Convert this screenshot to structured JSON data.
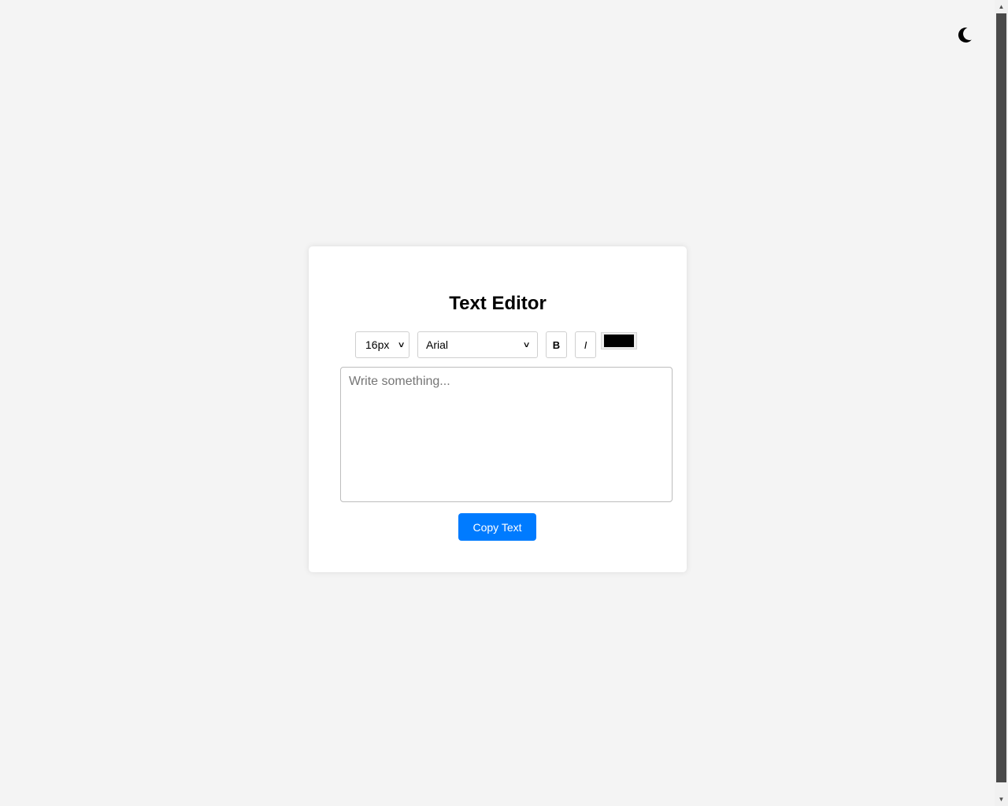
{
  "theme_toggle": {
    "icon": "moon-icon"
  },
  "editor_card": {
    "title": "Text Editor",
    "toolbar": {
      "font_size": {
        "selected": "16px"
      },
      "font_family": {
        "selected": "Arial"
      },
      "bold_label": "B",
      "italic_label": "I",
      "text_color": "#000000"
    },
    "textarea": {
      "value": "",
      "placeholder": "Write something..."
    },
    "copy_button_label": "Copy Text"
  },
  "colors": {
    "page_background": "#f4f4f4",
    "card_background": "#ffffff",
    "accent": "#007bff"
  }
}
